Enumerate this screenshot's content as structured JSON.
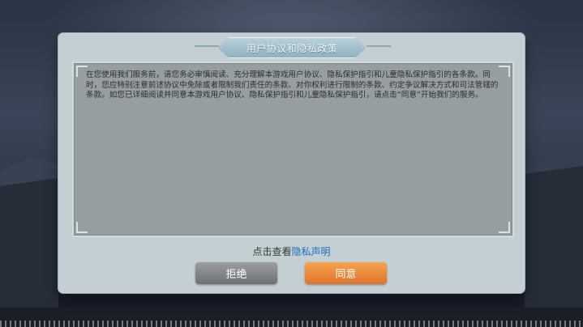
{
  "dialog": {
    "title": "用户协议和隐私政策",
    "body": "在您使用我们服务前，请您务必审慎阅读、充分理解本游戏用户协议、隐私保护指引和儿童隐私保护指引的各条款。同时，您应特别注意前述协议中免除或者限制我们责任的条款、对你权利进行限制的条款、约定争议解决方式和司法管辖的条款。如您已详细阅读并同意本游戏用户协议、隐私保护指引和儿童隐私保护指引，请点击“同意”开始我们的服务。",
    "privacy_prefix": "点击查看",
    "privacy_link": "隐私声明",
    "refuse_label": "拒绝",
    "agree_label": "同意"
  },
  "colors": {
    "link": "#1f6fc0",
    "agree_button": "#e0732a",
    "refuse_button": "#7e8285"
  }
}
